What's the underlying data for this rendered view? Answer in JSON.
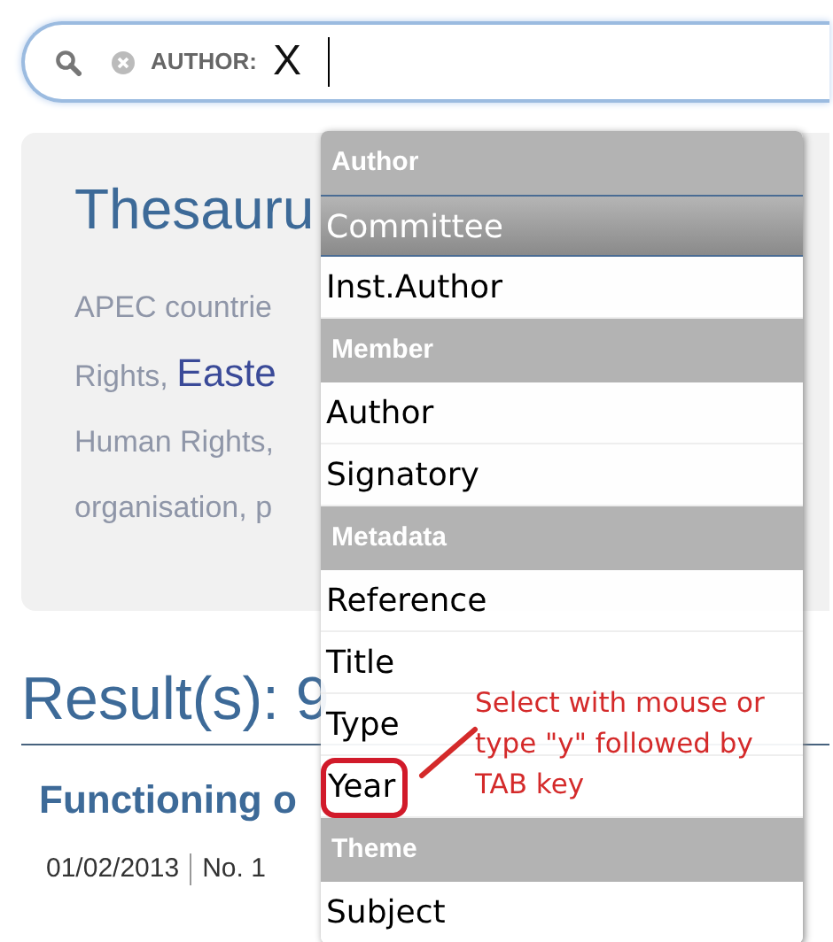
{
  "search": {
    "token_label": "AUTHOR:",
    "value": "X"
  },
  "panel": {
    "title": "Thesauru",
    "lines": [
      {
        "parts": [
          {
            "text": "APEC countrie",
            "emphasis": false
          }
        ]
      },
      {
        "parts": [
          {
            "text": "Rights,",
            "emphasis": false
          },
          {
            "text": "Easte",
            "emphasis": true
          }
        ]
      },
      {
        "parts": [
          {
            "text": "Human Rights,",
            "emphasis": false
          }
        ]
      },
      {
        "parts": [
          {
            "text": "organisation, p",
            "emphasis": false
          }
        ]
      }
    ]
  },
  "results": {
    "heading": "Result(s): 9",
    "first_title": "Functioning o",
    "meta": [
      "01/02/2013",
      "No. 1"
    ]
  },
  "dropdown": {
    "items": [
      {
        "kind": "header",
        "label": "Author"
      },
      {
        "kind": "option",
        "label": "Committee",
        "selected": true,
        "outlined": false
      },
      {
        "kind": "option",
        "label": "Inst.Author",
        "selected": false,
        "outlined": false
      },
      {
        "kind": "header",
        "label": "Member"
      },
      {
        "kind": "option",
        "label": "Author",
        "selected": false,
        "outlined": false
      },
      {
        "kind": "option",
        "label": "Signatory",
        "selected": false,
        "outlined": false
      },
      {
        "kind": "header",
        "label": "Metadata"
      },
      {
        "kind": "option",
        "label": "Reference",
        "selected": false,
        "outlined": false
      },
      {
        "kind": "option",
        "label": "Title",
        "selected": false,
        "outlined": false
      },
      {
        "kind": "option",
        "label": "Type",
        "selected": false,
        "outlined": false
      },
      {
        "kind": "option",
        "label": "Year",
        "selected": false,
        "outlined": true
      },
      {
        "kind": "header",
        "label": "Theme"
      },
      {
        "kind": "option",
        "label": "Subject",
        "selected": false,
        "outlined": false
      }
    ]
  },
  "annotation": {
    "text": "Select with mouse or type \"y\" followed by TAB key"
  }
}
